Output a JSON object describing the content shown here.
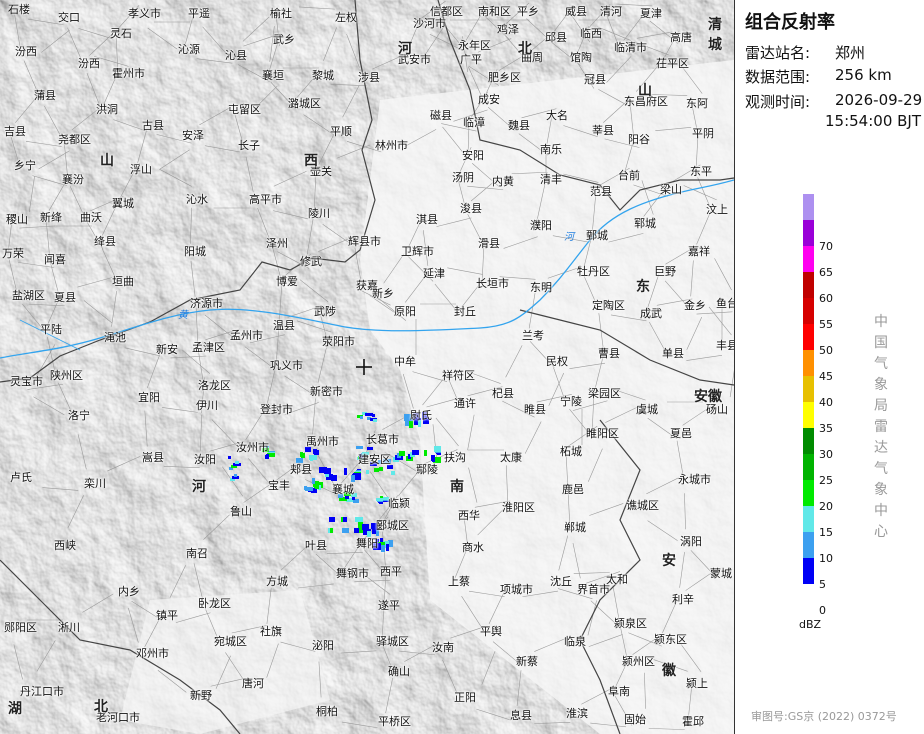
{
  "panel": {
    "title": "组合反射率",
    "station_label": "雷达站名:",
    "station_value": "郑州",
    "range_label": "数据范围:",
    "range_value": "256 km",
    "time_label": "观测时间:",
    "time_date": "2026-09-29",
    "time_clock": "15:54:00 BJT",
    "vertical_text": "中国气象局雷达气象中心",
    "approval": "审图号:GS京 (2022) 0372号",
    "unit": "dBZ",
    "legend": [
      {
        "value": "",
        "color": "#ad90f0"
      },
      {
        "value": "70",
        "color": "#9a00d8"
      },
      {
        "value": "65",
        "color": "#ff00f0"
      },
      {
        "value": "60",
        "color": "#c00000"
      },
      {
        "value": "55",
        "color": "#d60000"
      },
      {
        "value": "50",
        "color": "#ff0000"
      },
      {
        "value": "45",
        "color": "#ff9000"
      },
      {
        "value": "40",
        "color": "#e7c000"
      },
      {
        "value": "35",
        "color": "#ffff00"
      },
      {
        "value": "30",
        "color": "#008c00"
      },
      {
        "value": "25",
        "color": "#00b400"
      },
      {
        "value": "20",
        "color": "#00ea00"
      },
      {
        "value": "15",
        "color": "#60e8e8"
      },
      {
        "value": "10",
        "color": "#3ca0f0"
      },
      {
        "value": "5",
        "color": "#0000f6"
      },
      {
        "value": "0",
        "color": ""
      }
    ]
  },
  "places": [
    [
      "石楼",
      8,
      4
    ],
    [
      "交口",
      58,
      12
    ],
    [
      "孝义市",
      128,
      8
    ],
    [
      "平遥",
      188,
      8
    ],
    [
      "榆社",
      270,
      8
    ],
    [
      "左权",
      335,
      12
    ],
    [
      "信都区",
      430,
      6
    ],
    [
      "南和区",
      478,
      6
    ],
    [
      "平乡",
      517,
      6
    ],
    [
      "威县",
      565,
      6
    ],
    [
      "清河",
      600,
      6
    ],
    [
      "夏津",
      640,
      8
    ],
    [
      "鸡泽",
      497,
      24
    ],
    [
      "沙河市",
      413,
      18
    ],
    [
      "邱县",
      545,
      32
    ],
    [
      "临西",
      580,
      28
    ],
    [
      "高唐",
      670,
      32
    ],
    [
      "灵石",
      110,
      28
    ],
    [
      "武乡",
      273,
      34
    ],
    [
      "永年区",
      458,
      40
    ],
    [
      "曲周",
      521,
      52
    ],
    [
      "馆陶",
      570,
      52
    ],
    [
      "临清市",
      614,
      42
    ],
    [
      "汾西",
      15,
      46
    ],
    [
      "沁源",
      178,
      44
    ],
    [
      "沁县",
      225,
      50
    ],
    [
      "武安市",
      398,
      54
    ],
    [
      "广平",
      460,
      54
    ],
    [
      "霍州市",
      112,
      68
    ],
    [
      "襄垣",
      262,
      70
    ],
    [
      "黎城",
      312,
      70
    ],
    [
      "涉县",
      358,
      72
    ],
    [
      "肥乡区",
      488,
      72
    ],
    [
      "冠县",
      584,
      74
    ],
    [
      "茌平区",
      656,
      58
    ],
    [
      "汾西",
      78,
      58
    ],
    [
      "蒲县",
      34,
      90
    ],
    [
      "洪洞",
      96,
      104
    ],
    [
      "屯留区",
      228,
      104
    ],
    [
      "潞城区",
      288,
      98
    ],
    [
      "磁县",
      430,
      110
    ],
    [
      "成安",
      478,
      94
    ],
    [
      "大名",
      546,
      110
    ],
    [
      "东昌府区",
      624,
      96
    ],
    [
      "东阿",
      686,
      98
    ],
    [
      "古县",
      142,
      120
    ],
    [
      "临漳",
      463,
      117
    ],
    [
      "魏县",
      508,
      120
    ],
    [
      "莘县",
      592,
      125
    ],
    [
      "吉县",
      4,
      126
    ],
    [
      "尧都区",
      58,
      134
    ],
    [
      "安泽",
      182,
      130
    ],
    [
      "长子",
      238,
      140
    ],
    [
      "平顺",
      330,
      126
    ],
    [
      "南乐",
      540,
      144
    ],
    [
      "阳谷",
      628,
      134
    ],
    [
      "平阴",
      692,
      128
    ],
    [
      "乡宁",
      14,
      160
    ],
    [
      "浮山",
      130,
      164
    ],
    [
      "壶关",
      310,
      166
    ],
    [
      "林州市",
      375,
      140
    ],
    [
      "安阳",
      462,
      150
    ],
    [
      "清丰",
      540,
      174
    ],
    [
      "襄汾",
      62,
      174
    ],
    [
      "沁水",
      186,
      194
    ],
    [
      "高平市",
      249,
      194
    ],
    [
      "汤阴",
      452,
      172
    ],
    [
      "内黄",
      492,
      176
    ],
    [
      "台前",
      618,
      170
    ],
    [
      "东平",
      690,
      166
    ],
    [
      "翼城",
      112,
      198
    ],
    [
      "陵川",
      308,
      208
    ],
    [
      "淇县",
      416,
      214
    ],
    [
      "浚县",
      460,
      203
    ],
    [
      "范县",
      590,
      186
    ],
    [
      "梁山",
      660,
      184
    ],
    [
      "汶上",
      706,
      204
    ],
    [
      "稷山",
      6,
      214
    ],
    [
      "新绛",
      40,
      212
    ],
    [
      "曲沃",
      80,
      212
    ],
    [
      "辉县市",
      348,
      236
    ],
    [
      "卫辉市",
      401,
      246
    ],
    [
      "滑县",
      478,
      238
    ],
    [
      "濮阳",
      530,
      220
    ],
    [
      "鄄城",
      586,
      230
    ],
    [
      "郓城",
      634,
      218
    ],
    [
      "嘉祥",
      688,
      246
    ],
    [
      "绛县",
      94,
      236
    ],
    [
      "阳城",
      184,
      246
    ],
    [
      "泽州",
      266,
      238
    ],
    [
      "万荣",
      2,
      248
    ],
    [
      "闻喜",
      44,
      254
    ],
    [
      "修武",
      300,
      256
    ],
    [
      "获嘉",
      356,
      280
    ],
    [
      "延津",
      423,
      268
    ],
    [
      "长垣市",
      476,
      278
    ],
    [
      "牡丹区",
      577,
      266
    ],
    [
      "巨野",
      654,
      266
    ],
    [
      "盐湖区",
      12,
      290
    ],
    [
      "夏县",
      54,
      292
    ],
    [
      "垣曲",
      112,
      276
    ],
    [
      "博爱",
      276,
      276
    ],
    [
      "新乡",
      372,
      288
    ],
    [
      "东明",
      530,
      282
    ],
    [
      "定陶区",
      592,
      300
    ],
    [
      "金乡",
      684,
      300
    ],
    [
      "济源市",
      190,
      298
    ],
    [
      "武陟",
      314,
      306
    ],
    [
      "原阳",
      394,
      306
    ],
    [
      "封丘",
      454,
      306
    ],
    [
      "成武",
      640,
      308
    ],
    [
      "鱼台",
      716,
      298
    ],
    [
      "平陆",
      40,
      324
    ],
    [
      "渑池",
      104,
      332
    ],
    [
      "孟州市",
      230,
      330
    ],
    [
      "温县",
      273,
      320
    ],
    [
      "兰考",
      522,
      330
    ],
    [
      "新安",
      156,
      344
    ],
    [
      "孟津区",
      192,
      342
    ],
    [
      "荥阳市",
      322,
      336
    ],
    [
      "中牟",
      394,
      356
    ],
    [
      "民权",
      546,
      356
    ],
    [
      "曹县",
      598,
      348
    ],
    [
      "单县",
      662,
      348
    ],
    [
      "丰县",
      716,
      340
    ],
    [
      "灵宝市",
      10,
      376
    ],
    [
      "陕州区",
      50,
      370
    ],
    [
      "洛龙区",
      198,
      380
    ],
    [
      "巩义市",
      270,
      360
    ],
    [
      "新密市",
      310,
      386
    ],
    [
      "祥符区",
      442,
      370
    ],
    [
      "杞县",
      492,
      388
    ],
    [
      "宁陵",
      560,
      396
    ],
    [
      "梁园区",
      588,
      388
    ],
    [
      "虞城",
      636,
      404
    ],
    [
      "砀山",
      706,
      404
    ],
    [
      "宜阳",
      138,
      392
    ],
    [
      "伊川",
      196,
      400
    ],
    [
      "登封市",
      260,
      404
    ],
    [
      "睢县",
      524,
      404
    ],
    [
      "通许",
      454,
      398
    ],
    [
      "洛宁",
      68,
      410
    ],
    [
      "尉氏",
      410,
      410
    ],
    [
      "睢阳区",
      586,
      428
    ],
    [
      "夏邑",
      670,
      428
    ],
    [
      "汝州市",
      236,
      442
    ],
    [
      "禹州市",
      306,
      436
    ],
    [
      "长葛市",
      366,
      434
    ],
    [
      "扶沟",
      444,
      452
    ],
    [
      "太康",
      500,
      452
    ],
    [
      "柘城",
      560,
      446
    ],
    [
      "嵩县",
      142,
      452
    ],
    [
      "汝阳",
      194,
      454
    ],
    [
      "郏县",
      290,
      464
    ],
    [
      "建安区",
      358,
      454
    ],
    [
      "鄢陵",
      416,
      464
    ],
    [
      "卢氏",
      10,
      472
    ],
    [
      "栾川",
      84,
      478
    ],
    [
      "宝丰",
      268,
      480
    ],
    [
      "襄城",
      332,
      484
    ],
    [
      "永城市",
      678,
      474
    ],
    [
      "鹿邑",
      562,
      484
    ],
    [
      "淮阳区",
      502,
      502
    ],
    [
      "郸城",
      564,
      522
    ],
    [
      "谯城区",
      626,
      500
    ],
    [
      "临颍",
      388,
      498
    ],
    [
      "鲁山",
      230,
      506
    ],
    [
      "西华",
      458,
      510
    ],
    [
      "郾城区",
      376,
      520
    ],
    [
      "涡阳",
      680,
      536
    ],
    [
      "西峡",
      54,
      540
    ],
    [
      "叶县",
      305,
      540
    ],
    [
      "舞阳",
      356,
      538
    ],
    [
      "商水",
      462,
      542
    ],
    [
      "南召",
      186,
      548
    ],
    [
      "方城",
      266,
      576
    ],
    [
      "舞钢市",
      336,
      568
    ],
    [
      "西平",
      380,
      566
    ],
    [
      "上蔡",
      448,
      576
    ],
    [
      "项城市",
      500,
      584
    ],
    [
      "沈丘",
      550,
      576
    ],
    [
      "太和",
      606,
      574
    ],
    [
      "蒙城",
      710,
      568
    ],
    [
      "内乡",
      118,
      586
    ],
    [
      "镇平",
      156,
      610
    ],
    [
      "卧龙区",
      198,
      598
    ],
    [
      "社旗",
      260,
      626
    ],
    [
      "泌阳",
      312,
      640
    ],
    [
      "遂平",
      378,
      600
    ],
    [
      "平舆",
      480,
      626
    ],
    [
      "界首市",
      577,
      584
    ],
    [
      "利辛",
      672,
      594
    ],
    [
      "颍泉区",
      614,
      618
    ],
    [
      "淅川",
      58,
      622
    ],
    [
      "郧阳区",
      4,
      622
    ],
    [
      "宛城区",
      214,
      636
    ],
    [
      "驿城区",
      376,
      636
    ],
    [
      "汝南",
      432,
      642
    ],
    [
      "临泉",
      564,
      636
    ],
    [
      "颍东区",
      654,
      634
    ],
    [
      "邓州市",
      136,
      648
    ],
    [
      "唐河",
      242,
      678
    ],
    [
      "确山",
      388,
      666
    ],
    [
      "新蔡",
      516,
      656
    ],
    [
      "颍州区",
      622,
      656
    ],
    [
      "丹江口市",
      20,
      686
    ],
    [
      "老河口市",
      96,
      712
    ],
    [
      "新野",
      190,
      690
    ],
    [
      "正阳",
      454,
      692
    ],
    [
      "阜南",
      608,
      686
    ],
    [
      "颍上",
      686,
      678
    ],
    [
      "桐柏",
      316,
      706
    ],
    [
      "平桥区",
      378,
      716
    ],
    [
      "息县",
      510,
      710
    ],
    [
      "淮滨",
      566,
      708
    ],
    [
      "固始",
      624,
      714
    ],
    [
      "霍邱",
      682,
      716
    ],
    [
      "郑州",
      0,
      0
    ]
  ],
  "regions": [
    [
      "山",
      100,
      150
    ],
    [
      "西",
      304,
      150
    ],
    [
      "河",
      398,
      38
    ],
    [
      "北",
      518,
      38
    ],
    [
      "山",
      638,
      80
    ],
    [
      "东",
      636,
      276
    ],
    [
      "河",
      192,
      476
    ],
    [
      "南",
      450,
      476
    ],
    [
      "安",
      662,
      550
    ],
    [
      "徽",
      662,
      660
    ],
    [
      "安徽",
      694,
      386
    ],
    [
      "湖",
      8,
      698
    ],
    [
      "北",
      94,
      696
    ],
    [
      "清城",
      708,
      14
    ]
  ],
  "rivers": [
    [
      "黄",
      178,
      306
    ],
    [
      "河",
      564,
      228
    ]
  ]
}
